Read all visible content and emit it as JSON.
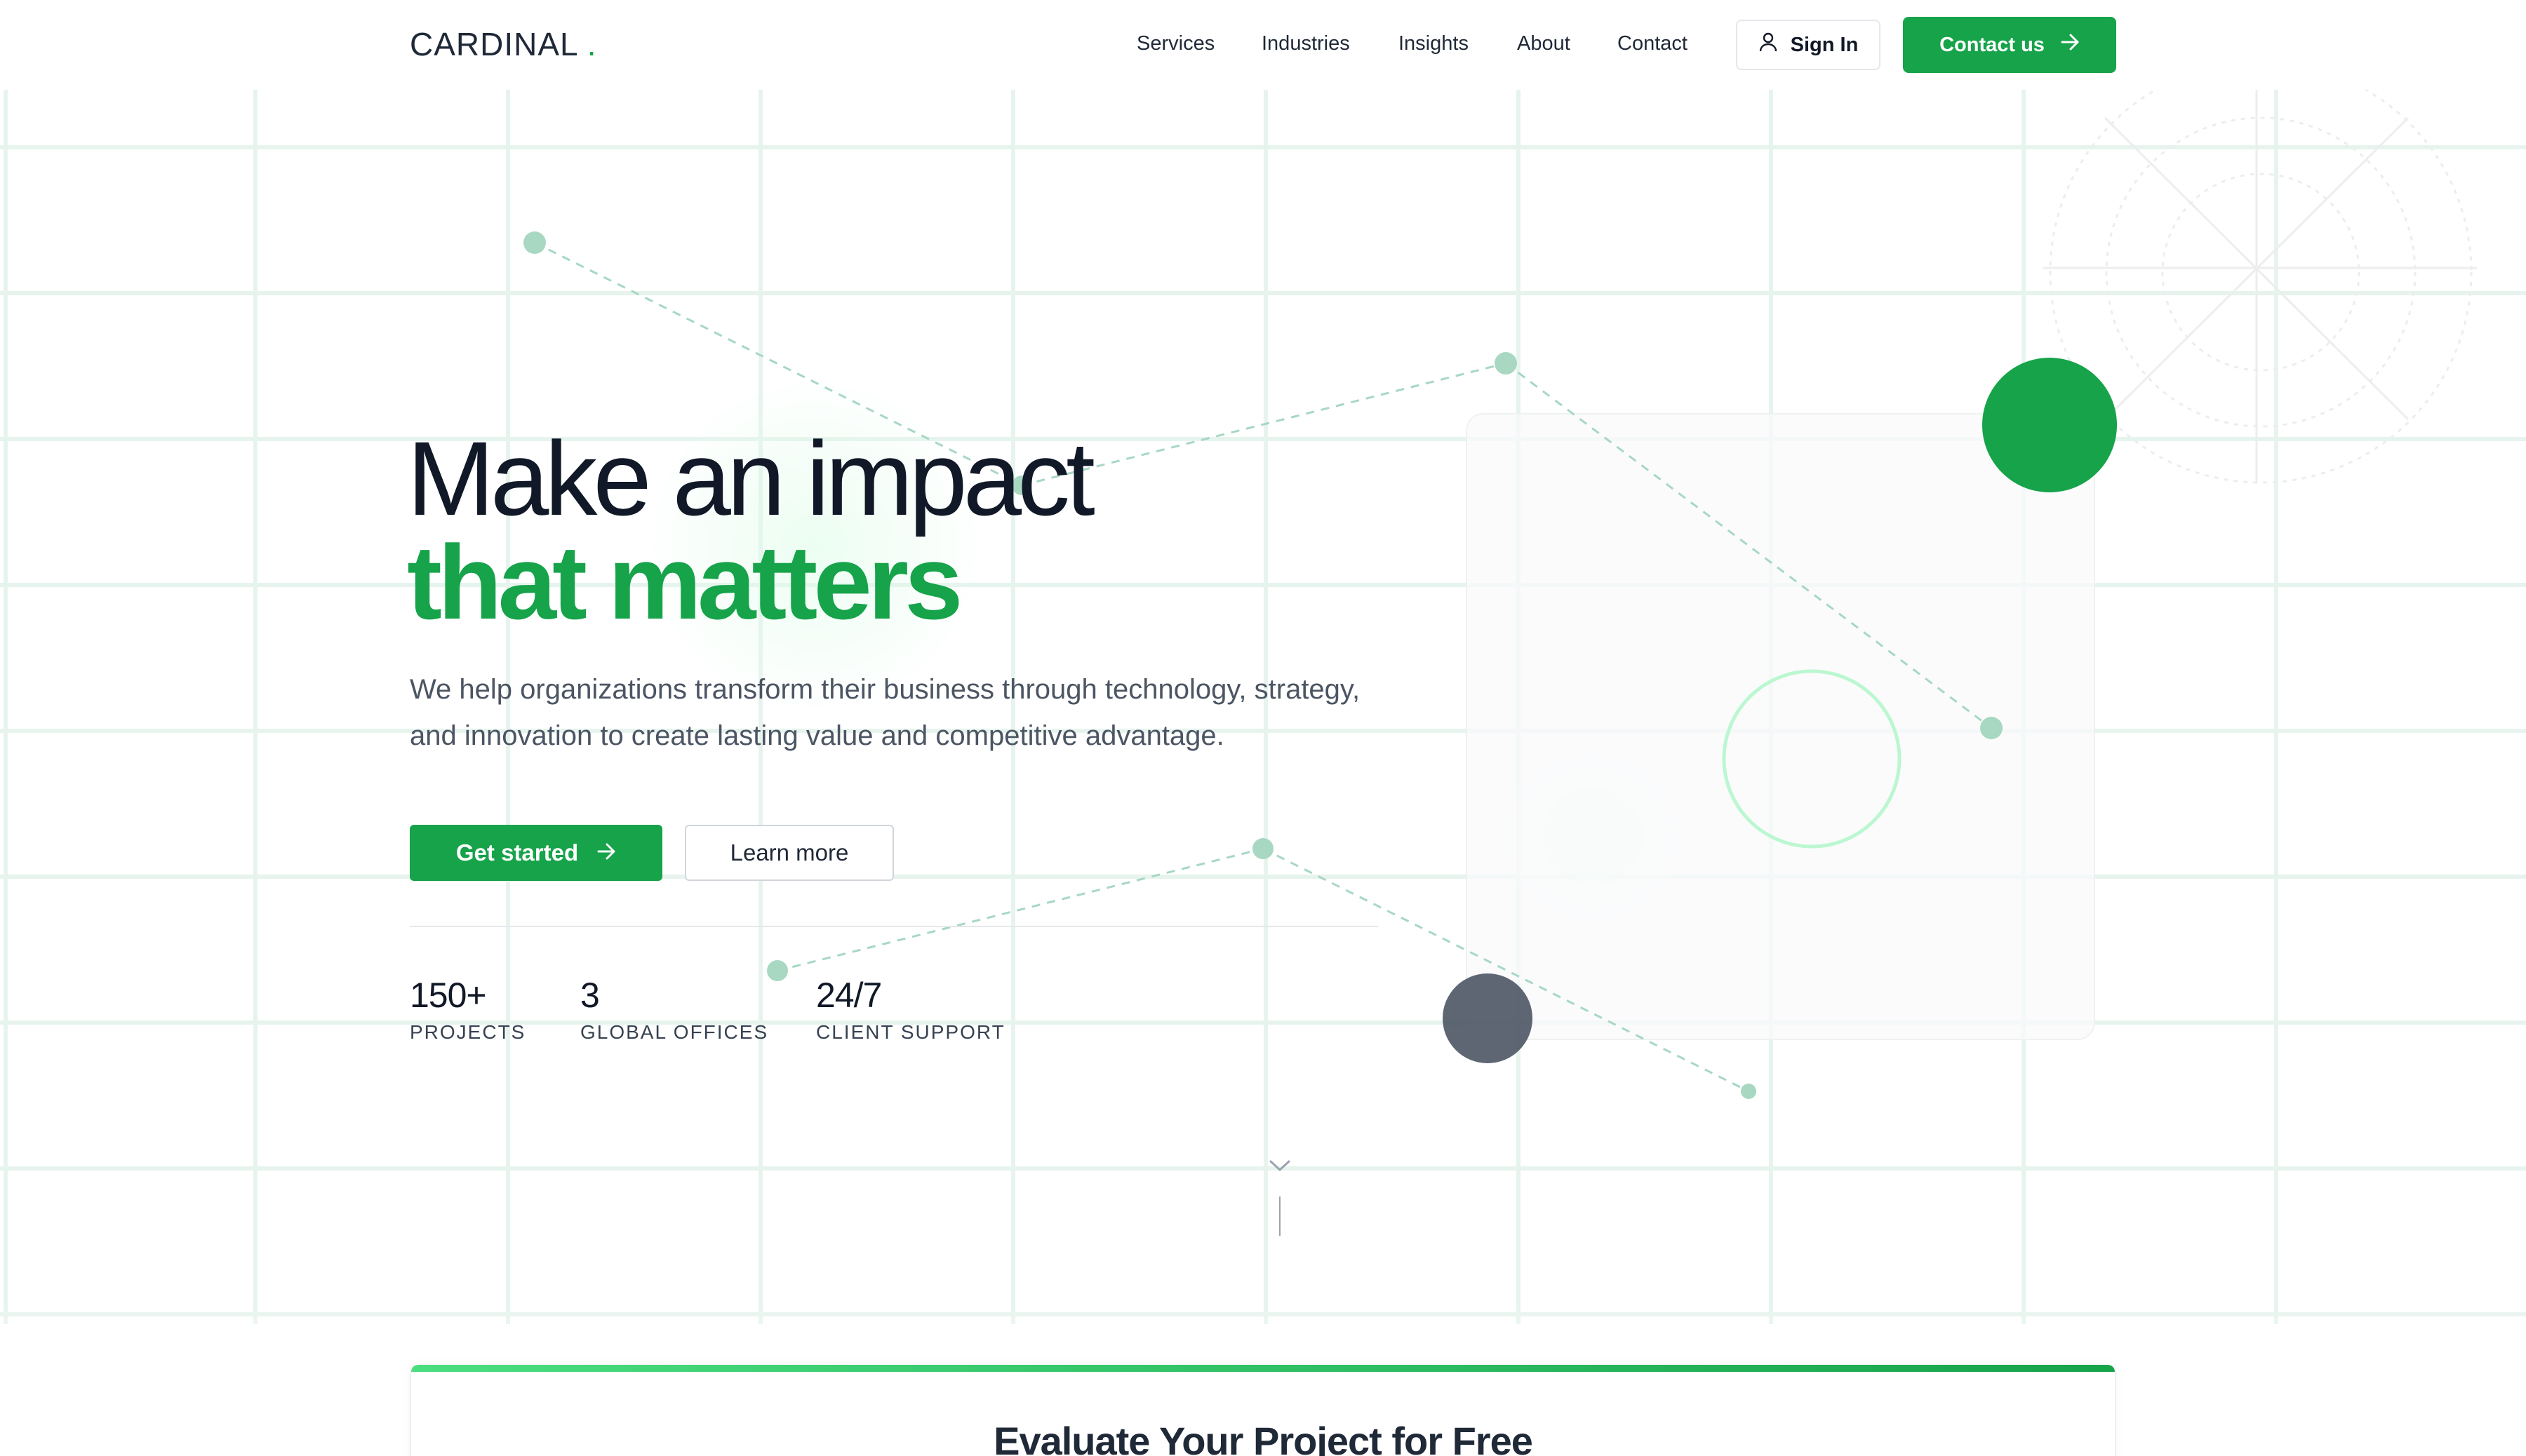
{
  "header": {
    "logo_text": "CARDINAL",
    "logo_dot": ".",
    "nav": [
      "Services",
      "Industries",
      "Insights",
      "About",
      "Contact"
    ],
    "signin_label": "Sign In",
    "contact_label": "Contact us"
  },
  "hero": {
    "title_line1": "Make an impact",
    "title_line2": "that matters",
    "description": "We help organizations transform their business through technology, strategy, and innovation to create lasting value and competitive advantage.",
    "primary_button": "Get started",
    "secondary_button": "Learn more",
    "stats": [
      {
        "value": "150+",
        "label": "PROJECTS"
      },
      {
        "value": "3",
        "label": "GLOBAL OFFICES"
      },
      {
        "value": "24/7",
        "label": "CLIENT SUPPORT"
      }
    ]
  },
  "evaluate": {
    "title": "Evaluate Your Project for Free"
  },
  "colors": {
    "brand_green": "#16a34a",
    "light_green": "#4ade80",
    "dark_gray": "#4b5563",
    "text_dark": "#111827"
  },
  "icons": {
    "signin": "user-icon",
    "contact": "arrow-right-icon",
    "get_started": "arrow-right-icon",
    "scroll": "chevron-down-icon"
  }
}
